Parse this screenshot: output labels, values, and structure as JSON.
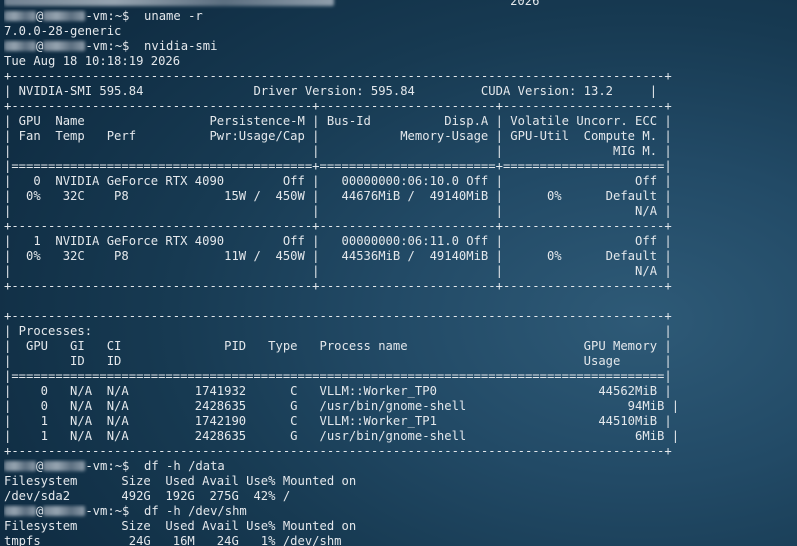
{
  "prompt": {
    "user_redacted": "",
    "host_suffix": "-vm",
    "suffix": ":~$"
  },
  "lines": [
    {
      "type": "partial",
      "text": "                        2026                 "
    },
    {
      "type": "prompt",
      "cmd": "  uname -r"
    },
    {
      "type": "text",
      "text": "7.0.0-28-generic"
    },
    {
      "type": "prompt",
      "cmd": "  nvidia-smi"
    },
    {
      "type": "text",
      "text": "Tue Aug 18 10:18:19 2026"
    },
    {
      "type": "text",
      "text": "+-----------------------------------------------------------------------------------------+"
    },
    {
      "type": "text",
      "text": "| NVIDIA-SMI 595.84               Driver Version: 595.84         CUDA Version: 13.2     |"
    },
    {
      "type": "text",
      "text": "+-----------------------------------------+------------------------+----------------------+"
    },
    {
      "type": "text",
      "text": "| GPU  Name                 Persistence-M | Bus-Id          Disp.A | Volatile Uncorr. ECC |"
    },
    {
      "type": "text",
      "text": "| Fan  Temp   Perf          Pwr:Usage/Cap |           Memory-Usage | GPU-Util  Compute M. |"
    },
    {
      "type": "text",
      "text": "|                                         |                        |               MIG M. |"
    },
    {
      "type": "text",
      "text": "|=========================================+========================+======================|"
    },
    {
      "type": "text",
      "text": "|   0  NVIDIA GeForce RTX 4090        Off |   00000000:06:10.0 Off |                  Off |"
    },
    {
      "type": "text",
      "text": "|  0%   32C    P8             15W /  450W |   44676MiB /  49140MiB |      0%      Default |"
    },
    {
      "type": "text",
      "text": "|                                         |                        |                  N/A |"
    },
    {
      "type": "text",
      "text": "+-----------------------------------------+------------------------+----------------------+"
    },
    {
      "type": "text",
      "text": "|   1  NVIDIA GeForce RTX 4090        Off |   00000000:06:11.0 Off |                  Off |"
    },
    {
      "type": "text",
      "text": "|  0%   32C    P8             11W /  450W |   44536MiB /  49140MiB |      0%      Default |"
    },
    {
      "type": "text",
      "text": "|                                         |                        |                  N/A |"
    },
    {
      "type": "text",
      "text": "+-----------------------------------------+------------------------+----------------------+"
    },
    {
      "type": "text",
      "text": ""
    },
    {
      "type": "text",
      "text": "+-----------------------------------------------------------------------------------------+"
    },
    {
      "type": "text",
      "text": "| Processes:                                                                              |"
    },
    {
      "type": "text",
      "text": "|  GPU   GI   CI              PID   Type   Process name                        GPU Memory |"
    },
    {
      "type": "text",
      "text": "|        ID   ID                                                               Usage      |"
    },
    {
      "type": "text",
      "text": "|=========================================================================================|"
    },
    {
      "type": "text",
      "text": "|    0   N/A  N/A         1741932      C   VLLM::Worker_TP0                      44562MiB |"
    },
    {
      "type": "text",
      "text": "|    0   N/A  N/A         2428635      G   /usr/bin/gnome-shell                      94MiB |"
    },
    {
      "type": "text",
      "text": "|    1   N/A  N/A         1742190      C   VLLM::Worker_TP1                      44510MiB |"
    },
    {
      "type": "text",
      "text": "|    1   N/A  N/A         2428635      G   /usr/bin/gnome-shell                       6MiB |"
    },
    {
      "type": "text",
      "text": "+-----------------------------------------------------------------------------------------+"
    },
    {
      "type": "prompt",
      "cmd": "  df -h /data"
    },
    {
      "type": "text",
      "text": "Filesystem      Size  Used Avail Use% Mounted on"
    },
    {
      "type": "text",
      "text": "/dev/sda2       492G  192G  275G  42% /"
    },
    {
      "type": "prompt",
      "cmd": "  df -h /dev/shm"
    },
    {
      "type": "text",
      "text": "Filesystem      Size  Used Avail Use% Mounted on"
    },
    {
      "type": "text",
      "text": "tmpfs            24G   16M   24G   1% /dev/shm"
    }
  ]
}
